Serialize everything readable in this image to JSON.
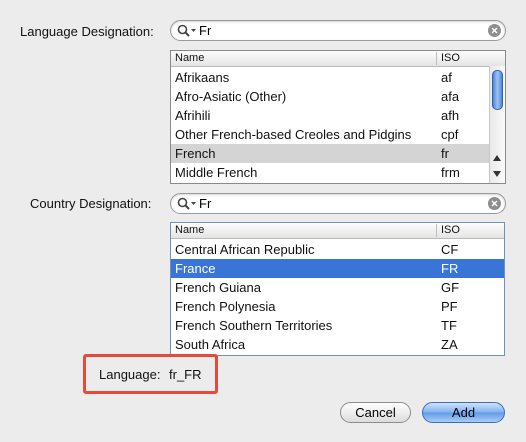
{
  "language_section": {
    "label": "Language Designation:",
    "search_value": "Fr",
    "columns": [
      "Name",
      "ISO"
    ],
    "rows": [
      {
        "name": "Afrikaans",
        "iso": "af"
      },
      {
        "name": "Afro-Asiatic (Other)",
        "iso": "afa"
      },
      {
        "name": "Afrihili",
        "iso": "afh"
      },
      {
        "name": "Other French-based Creoles and Pidgins",
        "iso": "cpf"
      },
      {
        "name": "French",
        "iso": "fr"
      },
      {
        "name": "Middle French",
        "iso": "frm"
      }
    ]
  },
  "country_section": {
    "label": "Country Designation:",
    "search_value": "Fr",
    "columns": [
      "Name",
      "ISO"
    ],
    "rows": [
      {
        "name": "Central African Republic",
        "iso": "CF"
      },
      {
        "name": "France",
        "iso": "FR"
      },
      {
        "name": "French Guiana",
        "iso": "GF"
      },
      {
        "name": "French Polynesia",
        "iso": "PF"
      },
      {
        "name": "French Southern Territories",
        "iso": "TF"
      },
      {
        "name": "South Africa",
        "iso": "ZA"
      }
    ]
  },
  "result": {
    "label": "Language:",
    "value": "fr_FR"
  },
  "buttons": {
    "cancel": "Cancel",
    "add": "Add"
  },
  "colors": {
    "selection_blue": "#3875d7",
    "selection_grey": "#d4d4d4",
    "highlight_border": "#e64b3a"
  }
}
